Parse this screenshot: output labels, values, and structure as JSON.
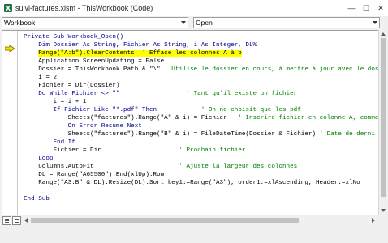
{
  "window": {
    "title": "suivi-factures.xlsm - ThisWorkbook (Code)",
    "app_icon": "excel-icon",
    "controls": {
      "minimize": "—",
      "maximize": "☐",
      "close": "✕"
    }
  },
  "toolbar": {
    "object_combo": "Workbook",
    "procedure_combo": "Open"
  },
  "code": {
    "lines": [
      [
        {
          "t": "Private Sub Workbook_Open()",
          "c": "kwline"
        }
      ],
      [
        {
          "t": "    Dim Dossier As String, Fichier As String, i As Integer, DL%",
          "c": "kwline"
        }
      ],
      [
        {
          "t": "    "
        },
        {
          "t": "Range(\"A:b\").ClearContents  ' Efface les colonnes A à b",
          "c": "hl"
        }
      ],
      [
        {
          "t": "    Application.ScreenUpdating = False"
        }
      ],
      [
        {
          "t": "    Dossier = ThisWorkbook.Path & \"\\\" "
        },
        {
          "t": "' Utilise le dossier en cours, à mettre à jour avec le dos",
          "c": "cm"
        }
      ],
      [
        {
          "t": "    i = 2"
        }
      ],
      [
        {
          "t": "    Fichier = Dir(Dossier)"
        }
      ],
      [
        {
          "t": "    Do While Fichier <> \"\"                  ",
          "c": "kw"
        },
        {
          "t": "' Tant qu'il existe un fichier",
          "c": "cm"
        }
      ],
      [
        {
          "t": "        i = i + 1"
        }
      ],
      [
        {
          "t": "        If Fichier Like \"*.pdf\" Then",
          "c": "kw"
        },
        {
          "t": "            "
        },
        {
          "t": "' On ne choisit que les pdf",
          "c": "cm"
        }
      ],
      [
        {
          "t": "            Sheets(\"factures\").Range(\"A\" & i) = Fichier   "
        },
        {
          "t": "' Inscrire fichier en colonne A, comme",
          "c": "cm"
        }
      ],
      [
        {
          "t": "            On Error Resume Next",
          "c": "kw"
        }
      ],
      [
        {
          "t": "            Sheets(\"factures\").Range(\"B\" & i) = FileDateTime(Dossier & Fichier) "
        },
        {
          "t": "' Date de derni",
          "c": "cm"
        }
      ],
      [
        {
          "t": "        End If",
          "c": "kw"
        }
      ],
      [
        {
          "t": "        Fichier = Dir                     "
        },
        {
          "t": "' Prochain fichier",
          "c": "cm"
        }
      ],
      [
        {
          "t": "    Loop",
          "c": "kw"
        }
      ],
      [
        {
          "t": "    Columns.AutoFit                       "
        },
        {
          "t": "' Ajuste la largeur des colonnes",
          "c": "cm"
        }
      ],
      [
        {
          "t": "    DL = Range(\"A65500\").End(xlUp).Row"
        }
      ],
      [
        {
          "t": "    Range(\"A3:B\" & DL).Resize(DL).Sort key1:=Range(\"A3\"), order1:=xlAscending, Header:=xlNo"
        }
      ],
      [
        {
          "t": ""
        }
      ],
      [
        {
          "t": "End Sub",
          "c": "kw"
        }
      ]
    ]
  },
  "colors": {
    "keyword": "#00008b",
    "comment": "#008000",
    "highlight": "#ffff00",
    "exec_arrow": "#f5e400"
  }
}
